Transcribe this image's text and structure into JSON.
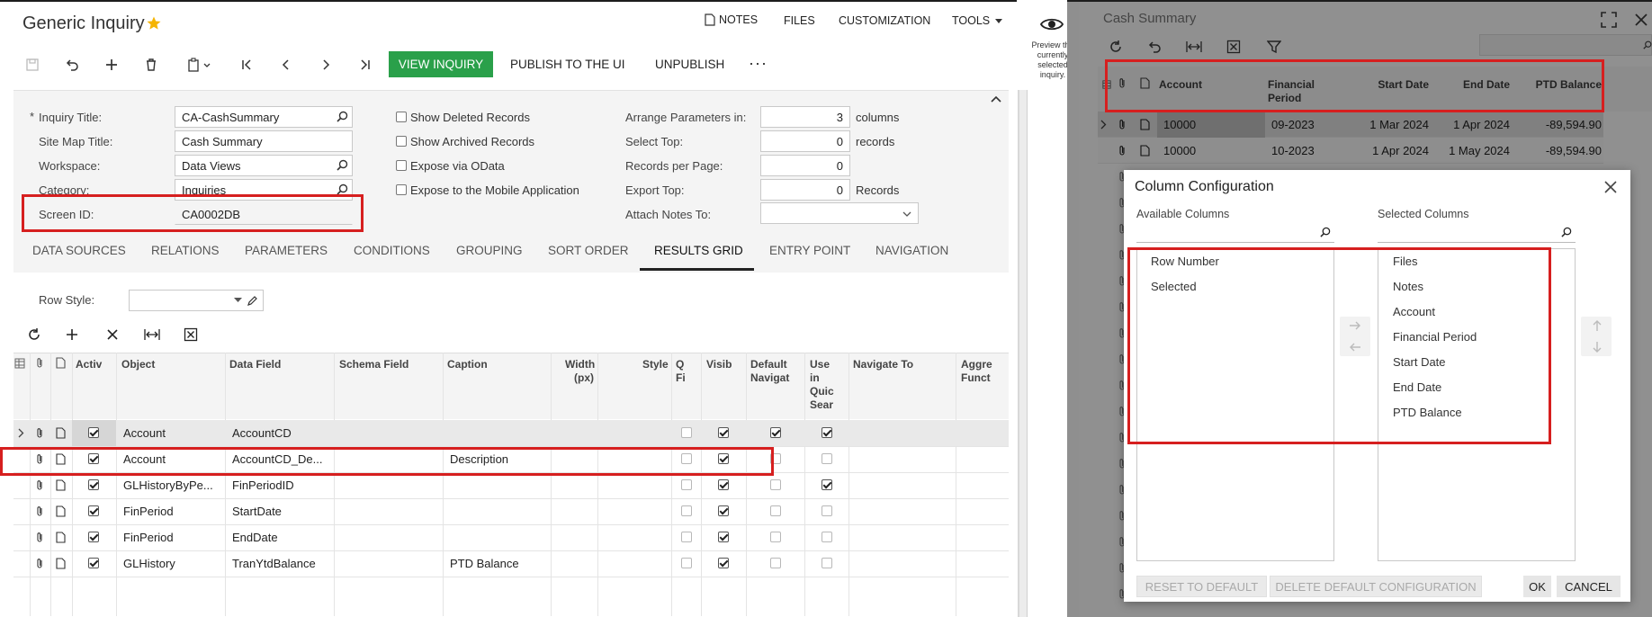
{
  "header": {
    "title": "Generic Inquiry",
    "star_icon": "star-icon",
    "notes": "NOTES",
    "files": "FILES",
    "customization": "CUSTOMIZATION",
    "tools": "TOOLS"
  },
  "toolbar": {
    "view_inquiry": "VIEW INQUIRY",
    "publish": "PUBLISH TO THE UI",
    "unpublish": "UNPUBLISH",
    "more": "···",
    "accent": "#2aa04a"
  },
  "form": {
    "inquiry_title_label": "Inquiry Title:",
    "inquiry_title_value": "CA-CashSummary",
    "site_map_title_label": "Site Map Title:",
    "site_map_title_value": "Cash Summary",
    "workspace_label": "Workspace:",
    "workspace_value": "Data Views",
    "category_label": "Category:",
    "category_value": "Inquiries",
    "screen_id_label": "Screen ID:",
    "screen_id_value": "CA0002DB",
    "show_deleted": "Show Deleted Records",
    "show_archived": "Show Archived Records",
    "expose_odata": "Expose via OData",
    "expose_mobile": "Expose to the Mobile Application",
    "arrange_label": "Arrange Parameters in:",
    "arrange_value": "3",
    "arrange_unit": "columns",
    "select_top_label": "Select Top:",
    "select_top_value": "0",
    "select_top_unit": "records",
    "rpp_label": "Records per Page:",
    "rpp_value": "0",
    "export_top_label": "Export Top:",
    "export_top_value": "0",
    "export_top_unit": "Records",
    "attach_notes_label": "Attach Notes To:"
  },
  "tabs": [
    "DATA SOURCES",
    "RELATIONS",
    "PARAMETERS",
    "CONDITIONS",
    "GROUPING",
    "SORT ORDER",
    "RESULTS GRID",
    "ENTRY POINT",
    "NAVIGATION"
  ],
  "active_tab": "RESULTS GRID",
  "row_style_label": "Row Style:",
  "grid": {
    "headers": {
      "active": "Activ",
      "object": "Object",
      "data_field": "Data Field",
      "schema_field": "Schema Field",
      "caption": "Caption",
      "width": "Width (px)",
      "style": "Style",
      "qf": "Q Fi",
      "visible": "Visib",
      "default_nav": "Default Navigat",
      "use_quick": "Use in Quic Sear",
      "navigate_to": "Navigate To",
      "aggregate": "Aggre Funct"
    },
    "rows": [
      {
        "object": "Account",
        "data_field": "AccountCD",
        "caption": ""
      },
      {
        "object": "Account",
        "data_field": "AccountCD_De...",
        "caption": "Description"
      },
      {
        "object": "GLHistoryByPe...",
        "data_field": "FinPeriodID",
        "caption": ""
      },
      {
        "object": "FinPeriod",
        "data_field": "StartDate",
        "caption": ""
      },
      {
        "object": "FinPeriod",
        "data_field": "EndDate",
        "caption": ""
      },
      {
        "object": "GLHistory",
        "data_field": "TranYtdBalance",
        "caption": "PTD Balance"
      }
    ]
  },
  "preview": {
    "text": "Preview the currently selected inquiry."
  },
  "cash_summary": {
    "title": "Cash Summary",
    "headers": {
      "account": "Account",
      "financial_period": "Financial Period",
      "start_date": "Start Date",
      "end_date": "End Date",
      "ptd_balance": "PTD Balance"
    },
    "rows": [
      {
        "account": "10000",
        "period": "09-2023",
        "start": "1 Mar 2024",
        "end": "1 Apr 2024",
        "balance": "-89,594.90"
      },
      {
        "account": "10000",
        "period": "10-2023",
        "start": "1 Apr 2024",
        "end": "1 May 2024",
        "balance": "-89,594.90"
      }
    ]
  },
  "dialog": {
    "title": "Column Configuration",
    "available_label": "Available Columns",
    "selected_label": "Selected Columns",
    "available": [
      "Row Number",
      "Selected"
    ],
    "selected": [
      "Files",
      "Notes",
      "Account",
      "Financial Period",
      "Start Date",
      "End Date",
      "PTD Balance"
    ],
    "reset": "RESET TO DEFAULT",
    "delete": "DELETE DEFAULT CONFIGURATION",
    "ok": "OK",
    "cancel": "CANCEL"
  },
  "highlight_color": "#d61f1f"
}
